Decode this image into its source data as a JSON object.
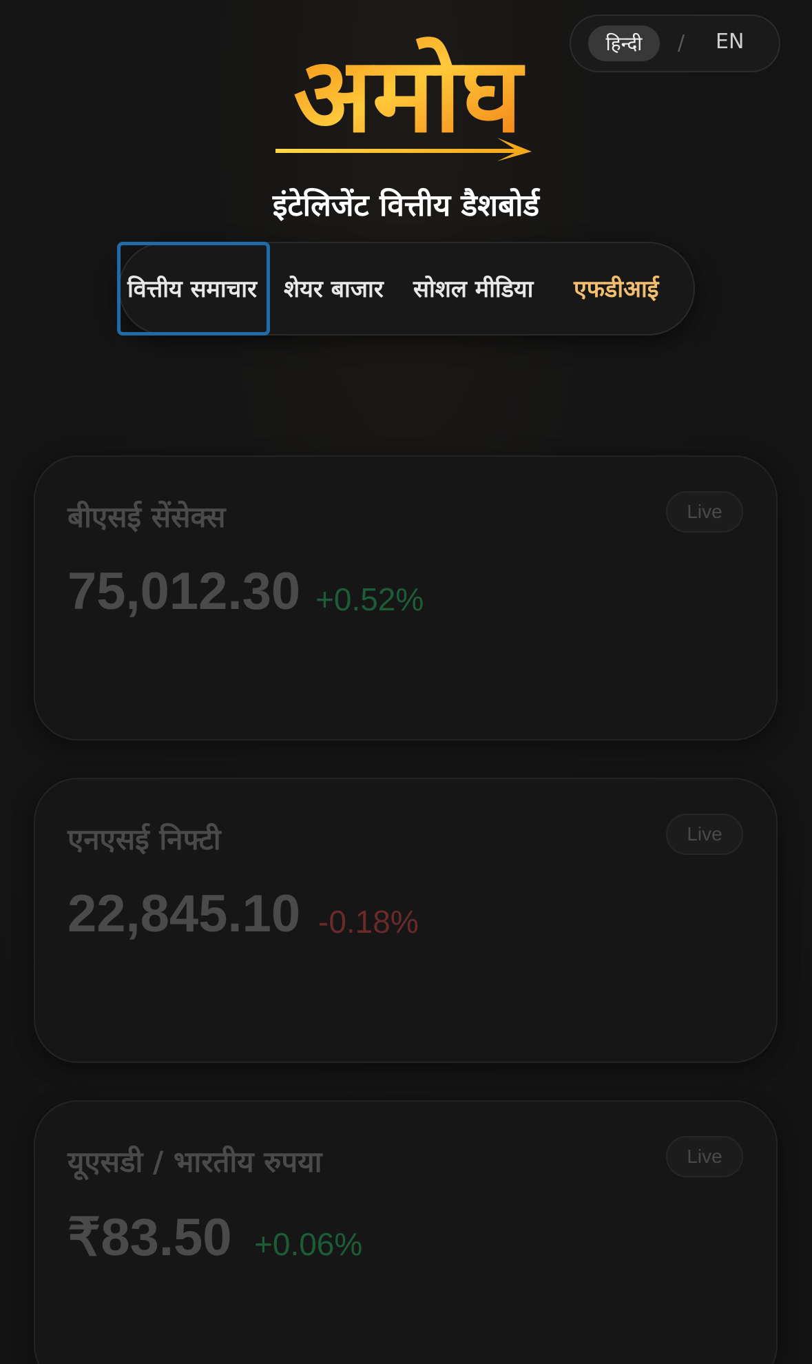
{
  "language_toggle": {
    "active": "हिन्दी",
    "separator": "/",
    "other": "EN"
  },
  "brand": {
    "logo_text": "अमोघ",
    "subtitle": "इंटेलिजेंट वित्तीय डैशबोर्ड"
  },
  "nav": {
    "tabs": [
      {
        "label": "वित्तीय समाचार",
        "focused": true
      },
      {
        "label": "शेयर बाजार"
      },
      {
        "label": "सोशल मीडिया"
      },
      {
        "label": "एफडीआई",
        "highlight_color": "#f3be6d"
      }
    ]
  },
  "cards": [
    {
      "title": "बीएसई सेंसेक्स",
      "badge": "Live",
      "value": "75,012.30",
      "change": "+0.52%",
      "direction": "up"
    },
    {
      "title": "एनएसई निफ्टी",
      "badge": "Live",
      "value": "22,845.10",
      "change": "-0.18%",
      "direction": "down"
    },
    {
      "title": "यूएसडी / भारतीय रुपया",
      "badge": "Live",
      "value": "₹83.50",
      "change": "+0.06%",
      "direction": "up"
    }
  ],
  "colors": {
    "background": "#141414",
    "positive": "#1c5c36",
    "negative": "#6a2a2a",
    "accent": "#f3be6d",
    "focus": "#1e6ba8"
  }
}
